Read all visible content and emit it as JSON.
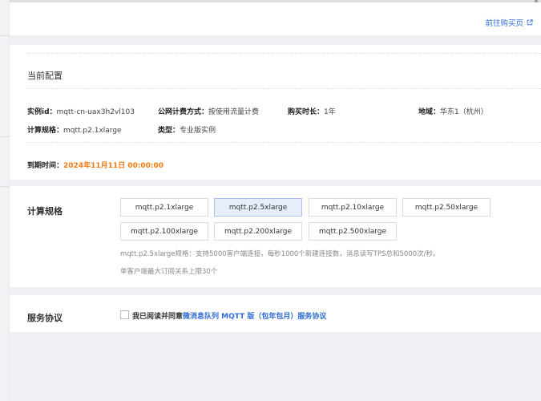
{
  "header": {
    "buy_link": "前往购买页"
  },
  "config": {
    "title": "当前配置",
    "instance_id": {
      "label": "实例id：",
      "value": "mqtt-cn-uax3h2vl103"
    },
    "billing": {
      "label": "公网计费方式：",
      "value": "按使用流量计费"
    },
    "duration": {
      "label": "购买时长：",
      "value": "1年"
    },
    "region": {
      "label": "地域：",
      "value": "华东1（杭州）"
    },
    "spec": {
      "label": "计算规格：",
      "value": "mqtt.p2.1xlarge"
    },
    "type": {
      "label": "类型：",
      "value": "专业版实例"
    },
    "expire": {
      "label": "到期时间：",
      "value": "2024年11月11日 00:00:00"
    }
  },
  "spec_section": {
    "label": "计算规格",
    "options": [
      "mqtt.p2.1xlarge",
      "mqtt.p2.5xlarge",
      "mqtt.p2.10xlarge",
      "mqtt.p2.50xlarge",
      "mqtt.p2.100xlarge",
      "mqtt.p2.200xlarge",
      "mqtt.p2.500xlarge"
    ],
    "selected": "mqtt.p2.5xlarge",
    "description": "mqtt.p2.5xlarge规格：支持5000客户端连接，每秒1000个新建连接数，消息读写TPS总和5000次/秒。",
    "note": "单客户端最大订阅关系上限30个"
  },
  "agreement": {
    "label": "服务协议",
    "text_prefix": "我已阅读并同意",
    "link_text": "微消息队列 MQTT 版（包年包月）服务协议",
    "checked": false
  },
  "colors": {
    "link": "#2f6bd5",
    "expire": "#f07a12",
    "selected_bg": "#e6eefb"
  }
}
